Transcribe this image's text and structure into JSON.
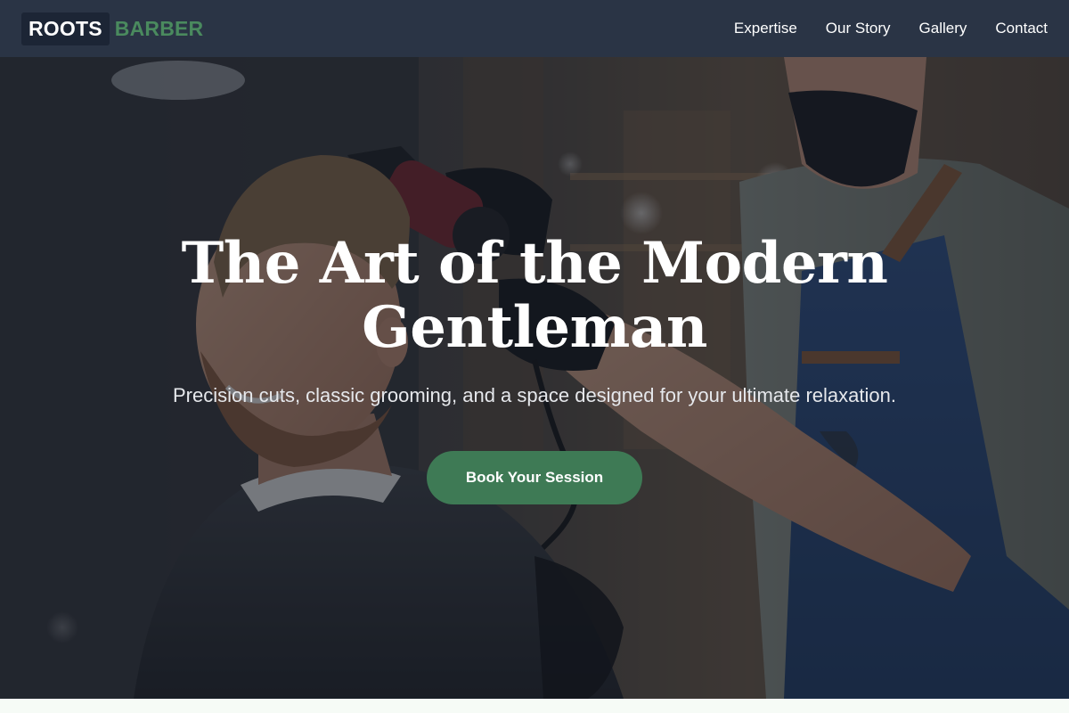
{
  "brand": {
    "name_primary": "ROOTS",
    "name_accent": "BARBER",
    "accent_color": "#4a8a5e",
    "nav_bg_color": "#2a3445"
  },
  "nav": {
    "links": [
      {
        "label": "Expertise"
      },
      {
        "label": "Our Story"
      },
      {
        "label": "Gallery"
      },
      {
        "label": "Contact"
      }
    ]
  },
  "hero": {
    "title_line1": "The Art of the Modern",
    "title_line2": "Gentleman",
    "subtitle": "Precision cuts, classic grooming, and a space designed for your ultimate relaxation.",
    "cta_label": "Book Your Session",
    "cta_color": "#3e7a55",
    "background_image": "barber-blow-drying-client-hair-photo"
  }
}
